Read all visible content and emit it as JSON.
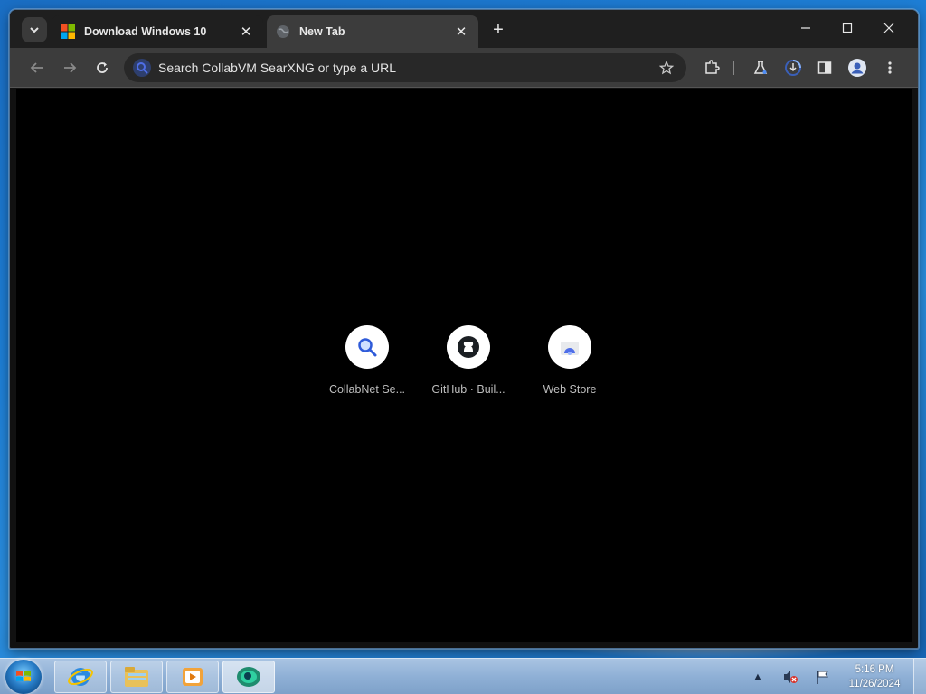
{
  "browser": {
    "tabs": [
      {
        "title": "Download Windows 10",
        "icon": "windows-logo-icon",
        "active": false
      },
      {
        "title": "New Tab",
        "icon": "globe-icon",
        "active": true
      }
    ],
    "new_tab_symbol": "+",
    "close_symbol": "✕",
    "omnibox": {
      "placeholder": "Search CollabVM SearXNG or type a URL",
      "value": ""
    },
    "shortcuts": [
      {
        "label": "CollabNet Se...",
        "icon": "magnifier-icon"
      },
      {
        "label": "GitHub · Buil...",
        "icon": "github-icon"
      },
      {
        "label": "Web Store",
        "icon": "web-store-icon"
      }
    ],
    "colors": {
      "tabstrip": "#1f1f1f",
      "toolbar": "#3c3c3c",
      "content": "#000000",
      "omnibox_icon": "#4f6ee8"
    }
  },
  "taskbar": {
    "clock_time": "5:16 PM",
    "clock_date": "11/26/2024",
    "apps": [
      "internet-explorer-icon",
      "file-explorer-icon",
      "media-player-icon",
      "browser-app-icon"
    ],
    "tray": [
      "show-hidden-icons-icon",
      "volume-muted-icon",
      "action-center-flag-icon"
    ],
    "tray_arrow": "▲"
  }
}
